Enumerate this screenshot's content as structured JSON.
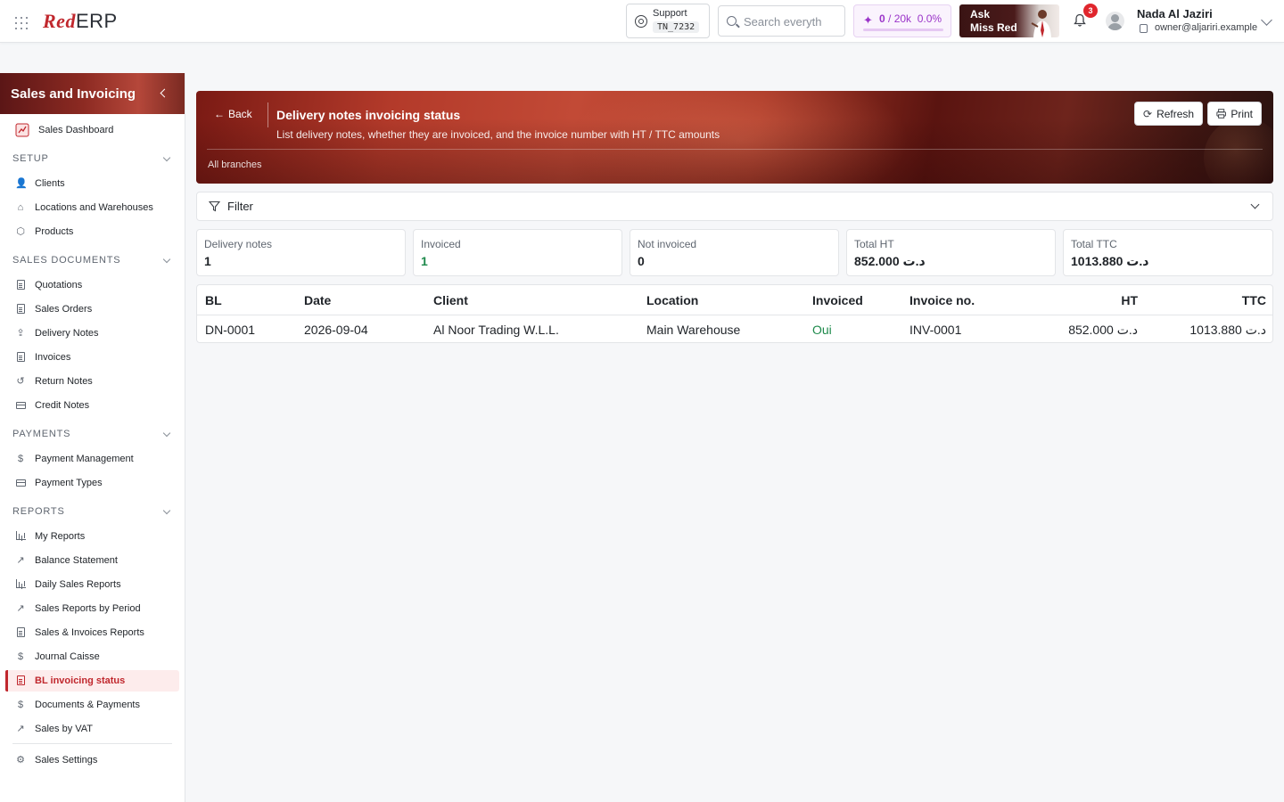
{
  "topbar": {
    "logo_red": "Red",
    "logo_erp": "ERP",
    "support_label": "Support",
    "support_code": "TN_7232",
    "search_placeholder": "Search everyth",
    "quota_used": "0",
    "quota_total": "/ 20k",
    "quota_percent": "0.0%",
    "quota_fraction": 0.0,
    "ask_line1": "Ask",
    "ask_line2": "Miss Red",
    "notification_count": "3",
    "user_name": "Nada Al Jaziri",
    "user_email": "owner@aljariri.example"
  },
  "sidebar": {
    "title": "Sales and Invoicing",
    "dashboard": "Sales Dashboard",
    "sections": {
      "setup": "SETUP",
      "sales_documents": "SALES DOCUMENTS",
      "payments": "PAYMENTS",
      "reports": "REPORTS"
    },
    "setup_items": [
      "Clients",
      "Locations and Warehouses",
      "Products"
    ],
    "sales_items": [
      "Quotations",
      "Sales Orders",
      "Delivery Notes",
      "Invoices",
      "Return Notes",
      "Credit Notes"
    ],
    "payment_items": [
      "Payment Management",
      "Payment Types"
    ],
    "report_items": [
      "My Reports",
      "Balance Statement",
      "Daily Sales Reports",
      "Sales Reports by Period",
      "Sales & Invoices Reports",
      "Journal Caisse",
      "BL invoicing status",
      "Documents & Payments",
      "Sales by VAT"
    ],
    "settings": "Sales Settings"
  },
  "header": {
    "back_label": "Back",
    "title": "Delivery notes invoicing status",
    "subtitle": "List delivery notes, whether they are invoiced, and the invoice number with HT / TTC amounts",
    "branch": "All branches",
    "refresh_label": "Refresh",
    "print_label": "Print"
  },
  "filter": {
    "label": "Filter"
  },
  "summary": [
    {
      "label": "Delivery notes",
      "value": "1"
    },
    {
      "label": "Invoiced",
      "value": "1"
    },
    {
      "label": "Not invoiced",
      "value": "0"
    },
    {
      "label": "Total HT",
      "value": "852.000 د.ت"
    },
    {
      "label": "Total TTC",
      "value": "1013.880 د.ت"
    }
  ],
  "table": {
    "columns": [
      "BL",
      "Date",
      "Client",
      "Location",
      "Invoiced",
      "Invoice no.",
      "HT",
      "TTC"
    ],
    "rows": [
      [
        "DN-0001",
        "2026-09-04",
        "Al Noor Trading W.L.L.",
        "Main Warehouse",
        "Oui",
        "INV-0001",
        "852.000 د.ت",
        "1013.880 د.ت"
      ]
    ]
  },
  "colors": {
    "brand": "#c0272d",
    "positive": "#1f8a4c",
    "quota": "#9b35c9"
  }
}
